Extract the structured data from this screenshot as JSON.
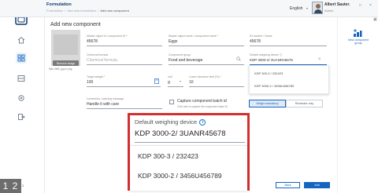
{
  "app": {
    "name": "Formulation",
    "breadcrumb": [
      "Formulation",
      "Add new formulation",
      "Add new component"
    ]
  },
  "header": {
    "language": "English",
    "user_name": "Albert Sauter",
    "user_role": "Admin",
    "window_controls": [
      "–",
      "□",
      "×"
    ]
  },
  "sidebar": {
    "items": [
      {
        "icon": "home-icon"
      },
      {
        "icon": "grid-icon",
        "active": true
      },
      {
        "icon": "storage-icon"
      },
      {
        "icon": "settings-icon"
      },
      {
        "icon": "logout-icon"
      }
    ]
  },
  "page": {
    "title": "Add new component"
  },
  "image_panel": {
    "remove_label": "Remove image",
    "hint": "Max 2MB, jpg or png"
  },
  "form": {
    "component_id": {
      "label": "Master object id / component ID *",
      "value": "45678"
    },
    "object_name": {
      "label": "Master object name / component name *",
      "value": "Eggs"
    },
    "id_number": {
      "label": "ID number / Name",
      "value": "45678"
    },
    "chemical_formula": {
      "label": "Chemical formula",
      "placeholder": "Chemical formula"
    },
    "component_group": {
      "label": "Component group",
      "value": "Food and beverage"
    },
    "weighing_device": {
      "label": "Default weighing device",
      "value": "KDP 3000-2/ 3UANR45678"
    },
    "target_weight": {
      "label": "Target weight *",
      "value": "100"
    },
    "unit": {
      "label": "unit",
      "value": "g"
    },
    "lower_tolerance": {
      "label": "Lower tolerance limit (%) *",
      "value": "10"
    },
    "comments": {
      "label": "Comments / warning message",
      "value": "Handle it with care"
    },
    "capture_batch": {
      "label": "Capture component batch id",
      "sub": "Click here to capture the component batch ID"
    },
    "toggle": {
      "on_label": "Weigh mandatory",
      "off_label": "Reminder only"
    }
  },
  "device_dropdown": {
    "options": [
      "KDP 300-3 / 232423",
      "KDP 3000-2 / 3456U456789"
    ]
  },
  "right_panel": {
    "label": "New component group"
  },
  "footer": {
    "back_label": "Back",
    "add_label": "Add"
  },
  "step_numbers": {
    "badge": "1 2",
    "small": "2"
  },
  "zoom_callout": {
    "label": "Default weighing device",
    "value": "KDP 3000-2/ 3UANR45678",
    "options": [
      "KDP 300-3 / 232423",
      "KDP 3000-2 / 3456U456789"
    ]
  },
  "colors": {
    "accent": "#1565c0",
    "callout_border": "#d32f2f"
  }
}
